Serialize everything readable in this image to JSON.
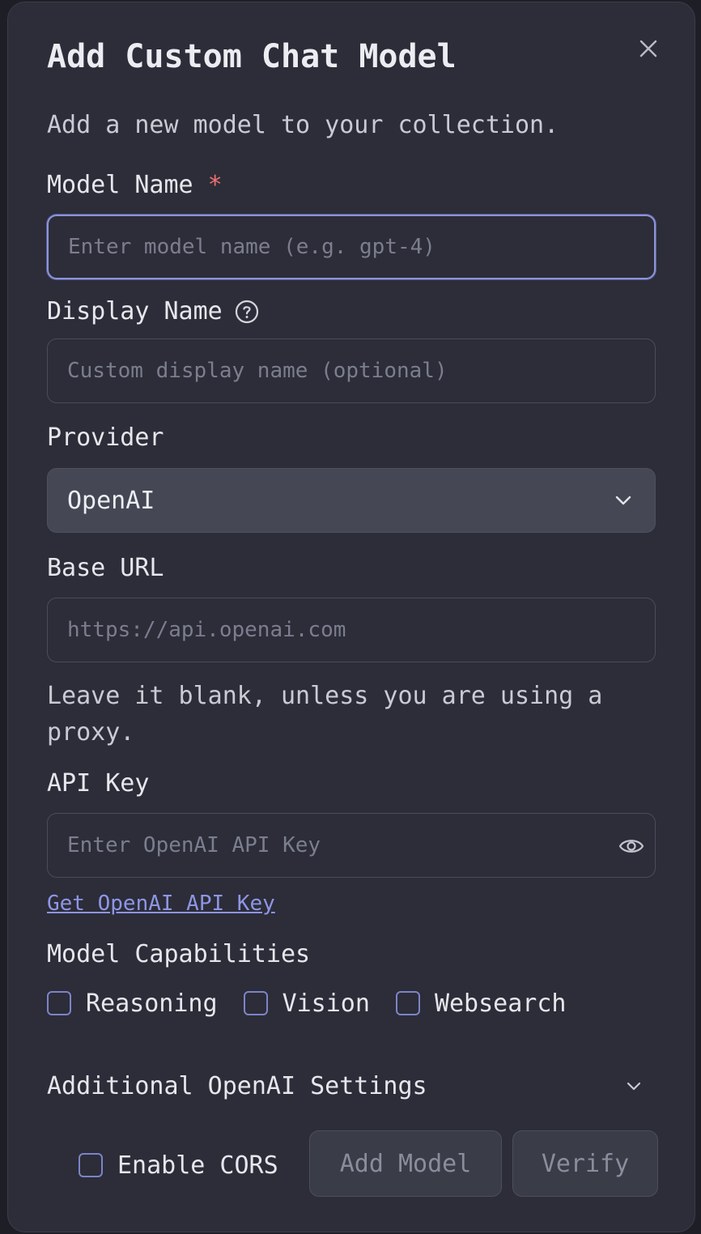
{
  "dialog": {
    "title": "Add Custom Chat Model",
    "subtitle": "Add a new model to your collection."
  },
  "fields": {
    "model_name": {
      "label": "Model Name",
      "required_mark": "*",
      "value": "",
      "placeholder": "Enter model name (e.g. gpt-4)"
    },
    "display_name": {
      "label": "Display Name",
      "value": "",
      "placeholder": "Custom display name (optional)"
    },
    "provider": {
      "label": "Provider",
      "selected": "OpenAI"
    },
    "base_url": {
      "label": "Base URL",
      "value": "",
      "placeholder": "https://api.openai.com",
      "hint": "Leave it blank, unless you are using a proxy."
    },
    "api_key": {
      "label": "API Key",
      "value": "",
      "placeholder": "Enter OpenAI API Key",
      "link": "Get OpenAI API Key"
    }
  },
  "capabilities": {
    "label": "Model Capabilities",
    "options": [
      {
        "label": "Reasoning",
        "checked": false
      },
      {
        "label": "Vision",
        "checked": false
      },
      {
        "label": "Websearch",
        "checked": false
      }
    ]
  },
  "additional_settings": {
    "label": "Additional OpenAI Settings",
    "expanded": false
  },
  "footer": {
    "cors_label": "Enable CORS",
    "cors_checked": false,
    "add_button": "Add Model",
    "verify_button": "Verify"
  },
  "icons": {
    "close": "close-icon",
    "help": "help-circle-icon",
    "select_chevron": "chevron-down-icon",
    "eye": "eye-icon",
    "accordion_chevron": "chevron-down-icon"
  },
  "colors": {
    "dialog_bg": "#2c2d38",
    "accent": "#8e95e6",
    "required": "#f0706f",
    "focus_border": "#8d93d8"
  }
}
